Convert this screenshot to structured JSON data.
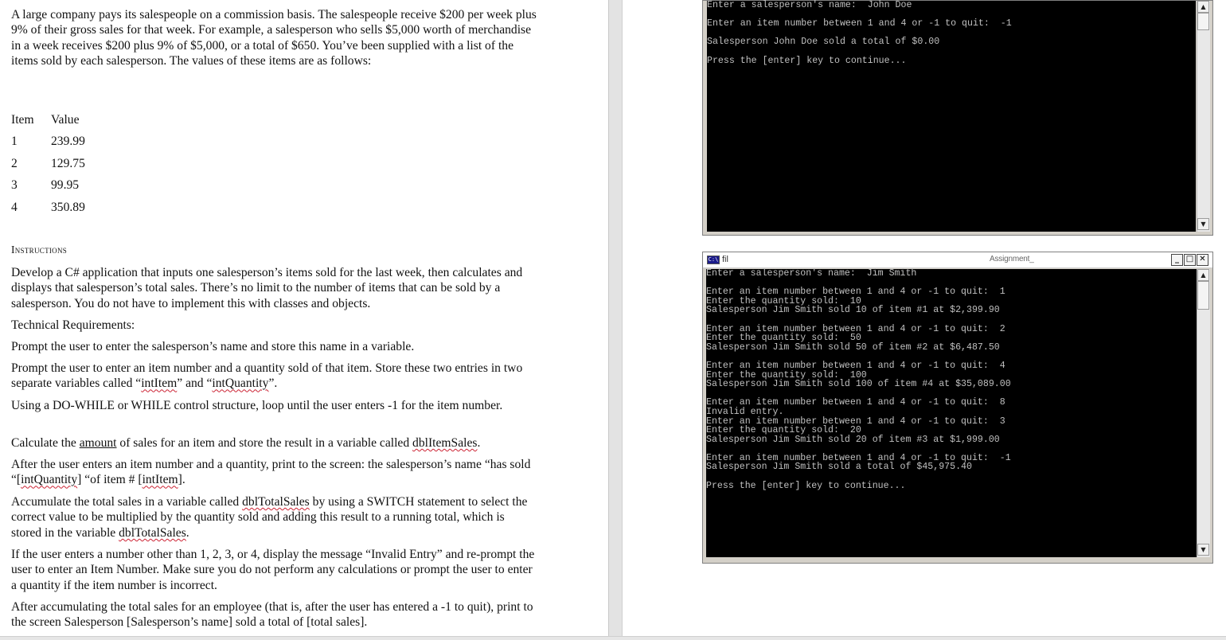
{
  "document": {
    "intro": "A large company pays its salespeople on a commission basis.  The salespeople receive $200 per week plus 9% of their gross sales for that week.  For example, a salesperson who sells $5,000 worth of merchandise in a week receives $200 plus 9% of $5,000, or a total of $650.  You’ve been supplied with a list of the items sold by each salesperson.  The values of these items are as follows:",
    "table_headers": [
      "Item",
      "Value"
    ],
    "items": [
      {
        "item": "1",
        "value": "239.99"
      },
      {
        "item": "2",
        "value": "129.75"
      },
      {
        "item": "3",
        "value": "99.95"
      },
      {
        "item": "4",
        "value": "350.89"
      }
    ],
    "instructions_heading": "Instructions",
    "p1": "Develop a C# application that inputs one salesperson’s items sold for the last week, then calculates and displays that salesperson’s total sales.  There’s no limit to the number of items that can be sold by a salesperson.  You do not have to implement this with classes and objects.",
    "p2": "Technical Requirements:",
    "p3": "Prompt the user to enter the salesperson’s name and store this name in a variable.",
    "p4_a": "Prompt the user to enter an item number and a quantity sold of that item.  Store these two entries in two separate variables called “",
    "p4_w1": "intItem",
    "p4_b": "” and “",
    "p4_w2": "intQuantity",
    "p4_c": "”.",
    "p5": "Using a DO-WHILE or WHILE control structure, loop until the user enters -1 for the item number.",
    "p6_a": "Calculate the ",
    "p6_u": "amount",
    "p6_b": " of sales for an item and store the result in a variable called ",
    "p6_w": "dblItemSales",
    "p6_c": ".",
    "p7_a": "After the user enters an item number and a quantity, print to the screen:   the salesperson’s name “has sold “[",
    "p7_w1": "intQuantity",
    "p7_b": "] “of item # [",
    "p7_w2": "intItem",
    "p7_c": "].",
    "p8_a": "Accumulate the total sales in a variable called ",
    "p8_w1": "dblTotalSales",
    "p8_b": " by using a SWITCH statement to select the correct value to be multiplied by the quantity sold and adding this result to a running total, which is stored in the variable ",
    "p8_w2": "dblTotalSales",
    "p8_c": ".",
    "p9": "If the user enters a number other than 1, 2, 3, or 4, display the message “Invalid Entry” and re-prompt the user to enter an Item Number.  Make sure you do not perform any calculations or prompt the user to enter a quantity if the item number is incorrect.",
    "p10": "After accumulating the total sales for an employee (that is, after the user has entered a -1 to quit), print to the screen Salesperson [Salesperson’s name] sold a total of [total sales]."
  },
  "console1": {
    "text": "Enter a salesperson's name:  John Doe\n\nEnter an item number between 1 and 4 or -1 to quit:  -1\n\nSalesperson John Doe sold a total of $0.00\n\nPress the [enter] key to continue..."
  },
  "console2": {
    "title_left": "fil",
    "title_right": "Assignment_",
    "text": "Enter a salesperson's name:  Jim Smith\n\nEnter an item number between 1 and 4 or -1 to quit:  1\nEnter the quantity sold:  10\nSalesperson Jim Smith sold 10 of item #1 at $2,399.90\n\nEnter an item number between 1 and 4 or -1 to quit:  2\nEnter the quantity sold:  50\nSalesperson Jim Smith sold 50 of item #2 at $6,487.50\n\nEnter an item number between 1 and 4 or -1 to quit:  4\nEnter the quantity sold:  100\nSalesperson Jim Smith sold 100 of item #4 at $35,089.00\n\nEnter an item number between 1 and 4 or -1 to quit:  8\nInvalid entry.\nEnter an item number between 1 and 4 or -1 to quit:  3\nEnter the quantity sold:  20\nSalesperson Jim Smith sold 20 of item #3 at $1,999.00\n\nEnter an item number between 1 and 4 or -1 to quit:  -1\nSalesperson Jim Smith sold a total of $45,975.40\n\nPress the [enter] key to continue..."
  },
  "icons": {
    "scroll_up": "▲",
    "scroll_down": "▼",
    "minimize": "_",
    "maximize": "□",
    "close": "✕",
    "cmd": "C:\\"
  }
}
